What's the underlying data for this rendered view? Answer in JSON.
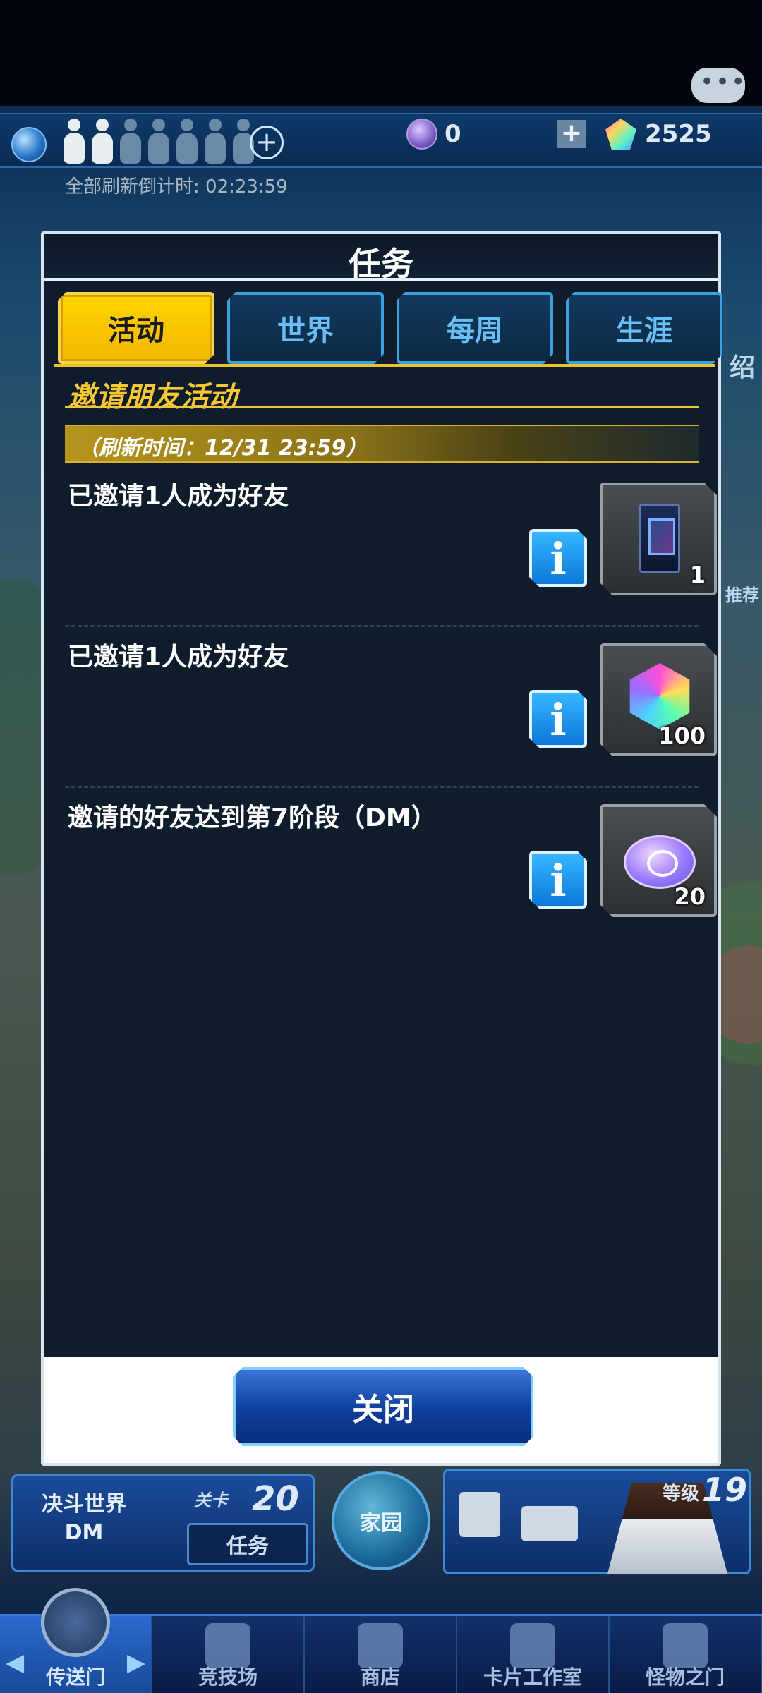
{
  "hud": {
    "refresh_countdown": "全部刷新倒计时: 02:23:59",
    "orb_count": "0",
    "gem_count": "2525",
    "icons": [
      "globe-icon",
      "player-slot-icon",
      "add-icon",
      "orb-icon",
      "plus-icon",
      "gem-icon",
      "chat-icon"
    ]
  },
  "background": {
    "side_label_1": "绍",
    "side_label_2": "推荐"
  },
  "dialog": {
    "title": "任务",
    "tabs": [
      {
        "label": "活动",
        "active": true
      },
      {
        "label": "世界",
        "active": false
      },
      {
        "label": "每周",
        "active": false
      },
      {
        "label": "生涯",
        "active": false
      }
    ],
    "event_title": "邀请朋友活动",
    "refresh_time": "（刷新时间：12/31 23:59）",
    "missions": [
      {
        "description": "已邀请1人成为好友",
        "reward_icon": "card-pack-icon",
        "reward_qty": "1"
      },
      {
        "description": "已邀请1人成为好友",
        "reward_icon": "gem-icon",
        "reward_qty": "100"
      },
      {
        "description": "邀请的好友达到第7阶段（DM）",
        "reward_icon": "coin-icon",
        "reward_qty": "20"
      }
    ],
    "info_label": "i",
    "close_label": "关闭"
  },
  "bottom": {
    "duel_world": "决斗世界",
    "duel_world_sub": "DM",
    "stage_label": "关卡",
    "stage_num": "20",
    "mission_button": "任务",
    "home_label": "家园",
    "level_label": "等级",
    "level_num": "19"
  },
  "nav": [
    {
      "label": "传送门",
      "active": true
    },
    {
      "label": "竞技场",
      "active": false
    },
    {
      "label": "商店",
      "active": false
    },
    {
      "label": "卡片工作室",
      "active": false
    },
    {
      "label": "怪物之门",
      "active": false
    }
  ],
  "colors": {
    "accent_yellow": "#f7c830",
    "tab_blue": "#68bff5",
    "dialog_bg": "#0e1c2c"
  }
}
